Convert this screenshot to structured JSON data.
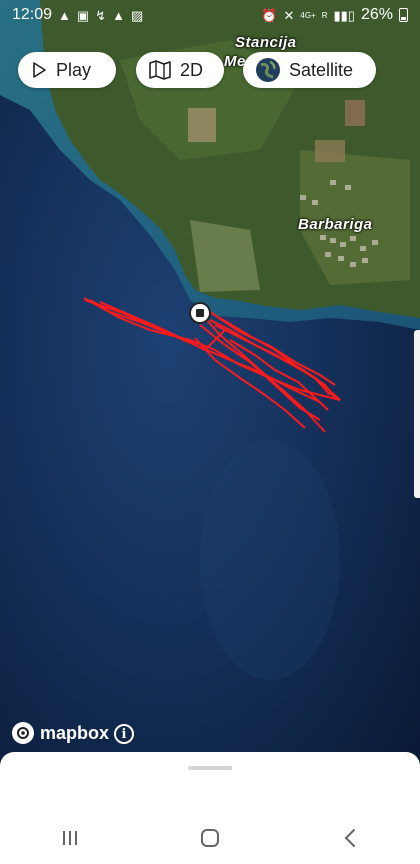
{
  "status": {
    "time": "12:09",
    "left_icons": [
      "warning-icon",
      "app-icon",
      "nav-arrow-icon",
      "warning-icon",
      "image-icon"
    ],
    "network": "4G+",
    "roaming": "R",
    "battery": "26%"
  },
  "toolbar": {
    "play_label": "Play",
    "view_label": "2D",
    "layer_label": "Satellite"
  },
  "map": {
    "places": [
      {
        "name": "Stancija"
      },
      {
        "name": "Me"
      },
      {
        "name": "Barbariga"
      }
    ],
    "track_color": "#ff1a1a",
    "attribution": "mapbox"
  },
  "nav": {
    "buttons": [
      "recent-apps-icon",
      "home-icon",
      "back-icon"
    ]
  }
}
